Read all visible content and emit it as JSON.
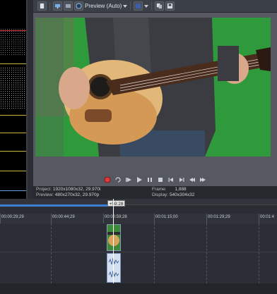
{
  "toolbar": {
    "preview_quality": "Preview (Auto)"
  },
  "icons": {
    "toolbar": [
      "doc-icon",
      "monitor-icon",
      "display-mode-icon",
      "preview-quality-icon",
      "grid-icon",
      "copy-icon",
      "save-icon"
    ],
    "transport": [
      "record-icon",
      "loop-icon",
      "play-from-start-icon",
      "play-icon",
      "pause-icon",
      "stop-icon",
      "prev-marker-icon",
      "next-marker-icon",
      "prev-frame-icon",
      "next-frame-icon"
    ]
  },
  "info": {
    "project_label": "Project:",
    "project_value": "1920x1080x32, 29.970i",
    "preview_label": "Preview:",
    "preview_value": "480x270x32, 29.970p",
    "frame_label": "Frame:",
    "frame_value": "1,888",
    "display_label": "Display:",
    "display_value": "540x304x32"
  },
  "timeline": {
    "marker_value": "+59:28",
    "timecodes": [
      "00:00:29;29",
      "00:00:44;29",
      "00:00:59;28",
      "00:01:15;00",
      "00:01:29;29",
      "00:01:4"
    ]
  },
  "colors": {
    "green_screen": "#2f9a3b",
    "timeline_blue": "#3d7fd6"
  }
}
